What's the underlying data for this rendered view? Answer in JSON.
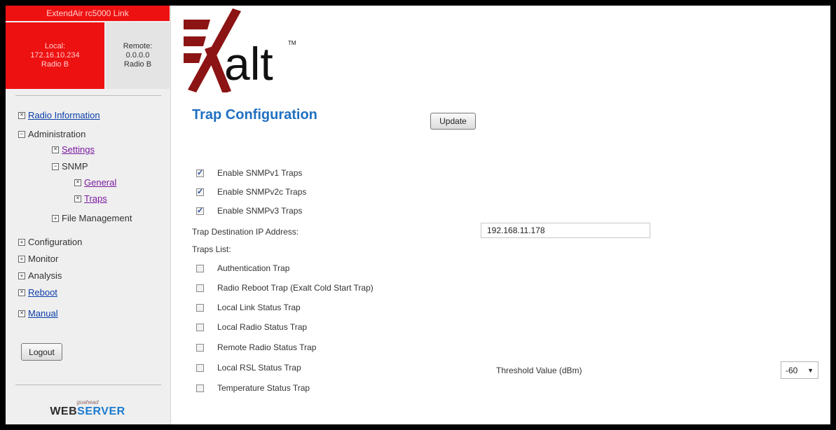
{
  "sidebar": {
    "header_title": "ExtendAir rc5000 Link",
    "local": {
      "label": "Local:",
      "ip": "172.16.10.234",
      "radio": "Radio B"
    },
    "remote": {
      "label": "Remote:",
      "ip": "0.0.0.0",
      "radio": "Radio B"
    },
    "nav": {
      "radio_information": "Radio Information",
      "administration": "Administration",
      "settings": "Settings",
      "snmp": "SNMP",
      "general": "General",
      "traps": "Traps",
      "file_management": "File Management",
      "configuration": "Configuration",
      "monitor": "Monitor",
      "analysis": "Analysis",
      "reboot": "Reboot",
      "manual": "Manual"
    },
    "logout_label": "Logout",
    "goahead_text": "goahead",
    "webserver_part1": "WEB",
    "webserver_part2": "SERVER"
  },
  "logo": {
    "brand_text": "alt",
    "trademark": "TM"
  },
  "main": {
    "title": "Trap Configuration",
    "update_label": "Update",
    "snmp_versions": [
      {
        "label": "Enable SNMPv1 Traps",
        "checked": true
      },
      {
        "label": "Enable SNMPv2c Traps",
        "checked": true
      },
      {
        "label": "Enable SNMPv3 Traps",
        "checked": true
      }
    ],
    "dest_label": "Trap Destination IP Address:",
    "dest_value": "192.168.11.178",
    "traps_list_label": "Traps List:",
    "traps": [
      {
        "label": "Authentication Trap",
        "checked": false
      },
      {
        "label": "Radio Reboot Trap (Exalt Cold Start Trap)",
        "checked": false
      },
      {
        "label": "Local Link Status Trap",
        "checked": false
      },
      {
        "label": "Local Radio Status Trap",
        "checked": false
      },
      {
        "label": "Remote Radio Status Trap",
        "checked": false
      },
      {
        "label": "Local RSL Status Trap",
        "checked": false
      },
      {
        "label": "Temperature Status Trap",
        "checked": false
      }
    ],
    "threshold_label": "Threshold Value (dBm)",
    "threshold_value": "-60"
  },
  "colors": {
    "accent_red": "#ee1111",
    "title_blue": "#1f6fc2",
    "logo_red": "#8c1414"
  }
}
